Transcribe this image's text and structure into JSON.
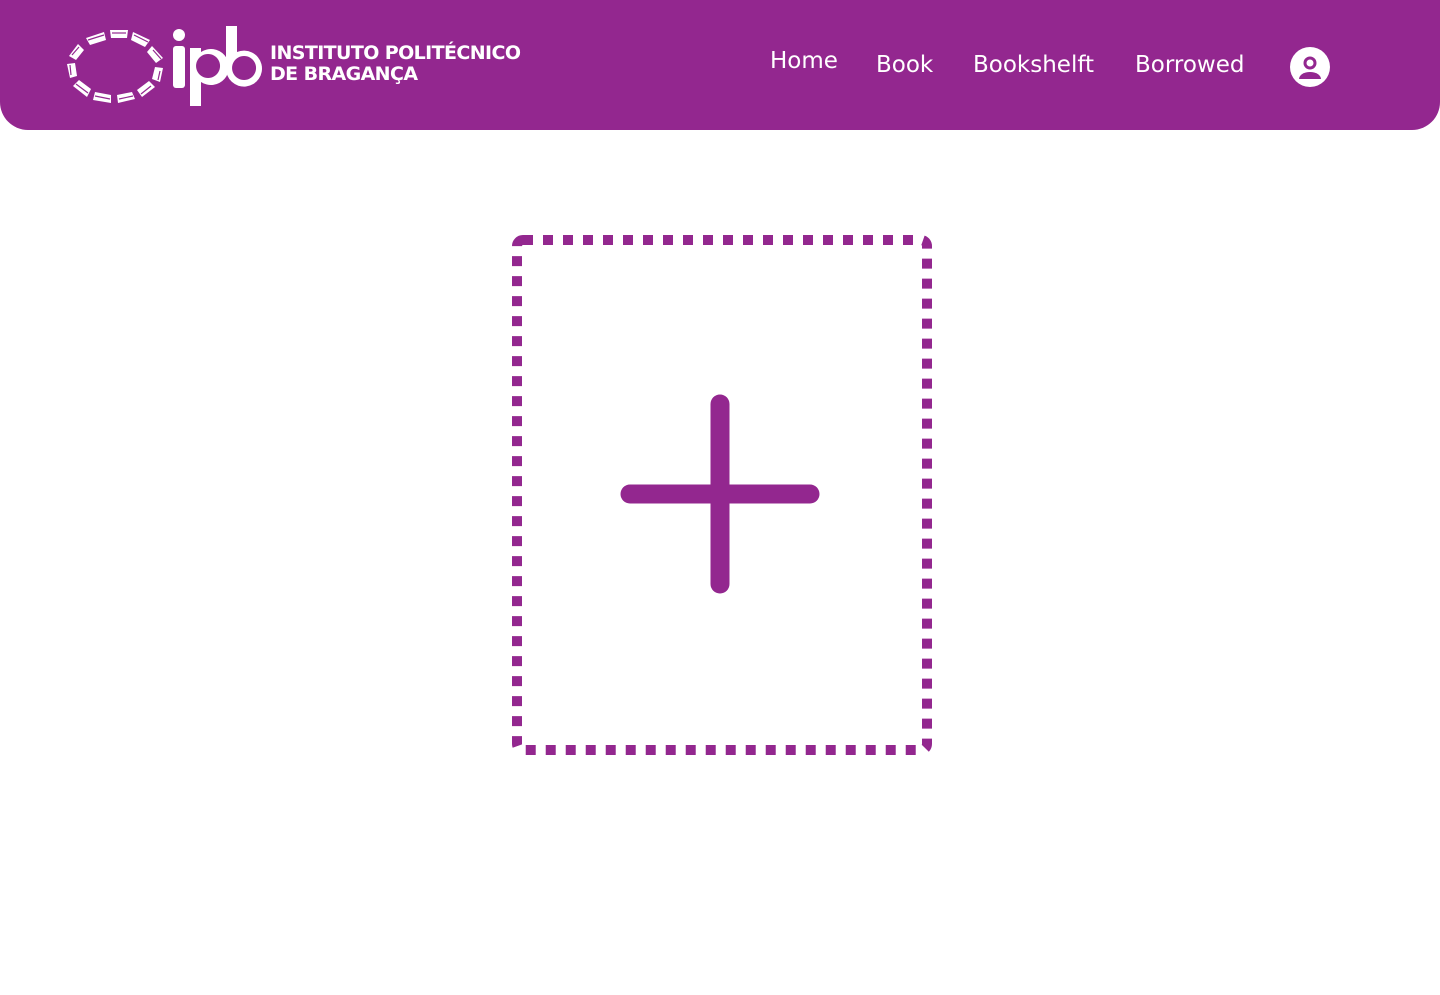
{
  "brand": {
    "short": "ipb",
    "line1": "INSTITUTO POLITÉCNICO",
    "line2": "DE BRAGANÇA",
    "icon": "ipb-emblem-icon"
  },
  "nav": {
    "items": [
      {
        "label": "Home"
      },
      {
        "label": "Book"
      },
      {
        "label": "Bookshelft"
      },
      {
        "label": "Borrowed"
      }
    ],
    "user_icon": "user-profile-icon"
  },
  "main": {
    "add_card_icon": "plus-icon"
  },
  "colors": {
    "primary": "#93278f",
    "background": "#ffffff",
    "text_on_primary": "#ffffff"
  }
}
